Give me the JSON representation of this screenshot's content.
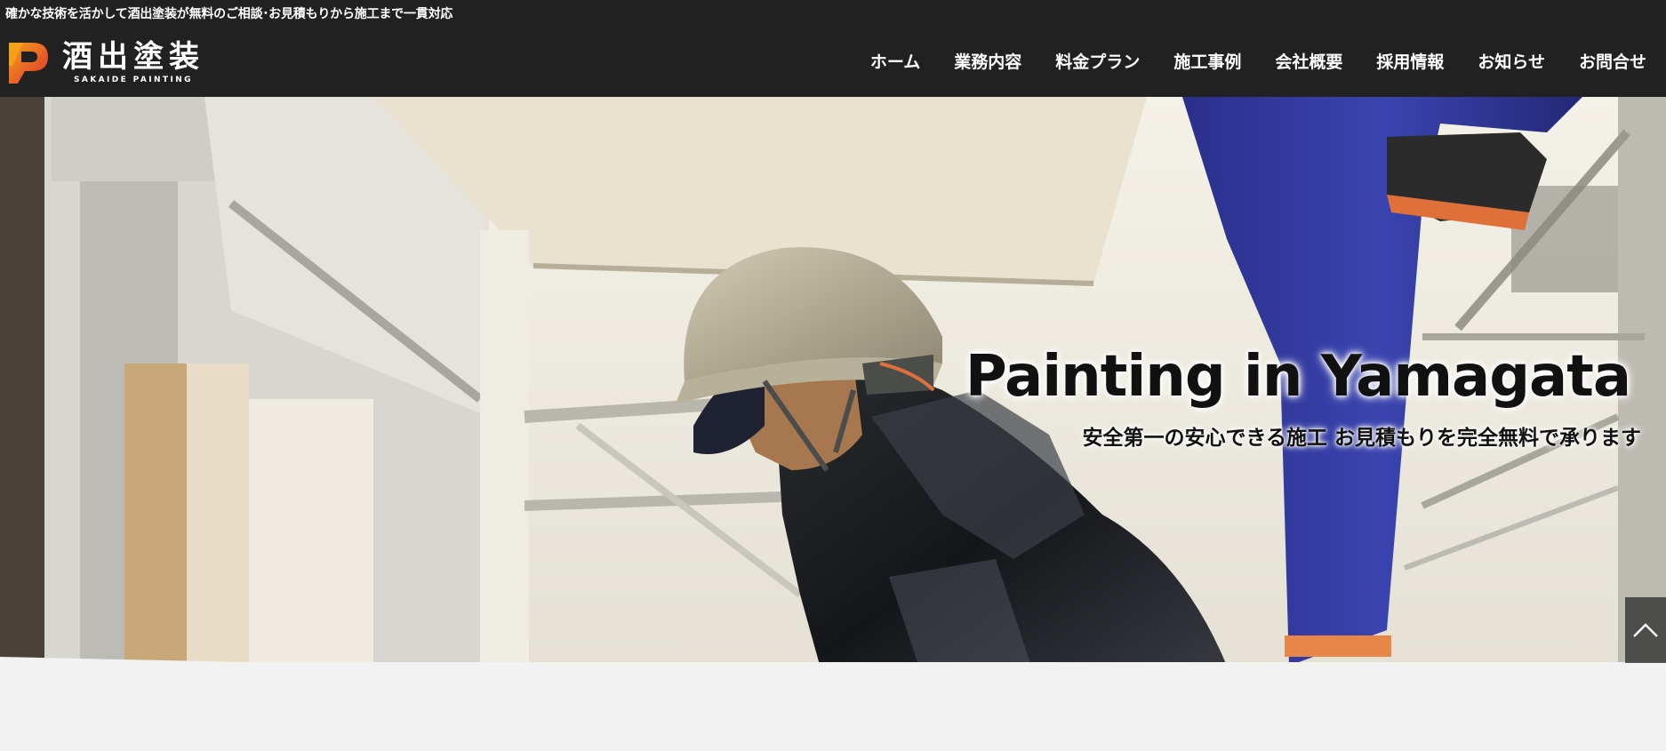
{
  "header": {
    "tagline": "確かな技術を活かして酒出塗装が無料のご相談･お見積もりから施工まで一貫対応",
    "logo": {
      "title": "酒出塗装",
      "subtitle": "SAKAIDE PAINTING",
      "mark_icon": "p-letter-logo-icon",
      "colors": {
        "orange": "#f5a21a",
        "red": "#e0302c"
      }
    },
    "nav": [
      {
        "label": "ホーム"
      },
      {
        "label": "業務内容"
      },
      {
        "label": "料金プラン"
      },
      {
        "label": "施工事例"
      },
      {
        "label": "会社概要"
      },
      {
        "label": "採用情報"
      },
      {
        "label": "お知らせ"
      },
      {
        "label": "お問合せ"
      }
    ],
    "background": "#212121"
  },
  "hero": {
    "title": "Painting in Yamagata",
    "subtitle": "安全第一の安心できる施工 お見積もりを完全無料で承ります",
    "image": "worker-in-helmet-on-scaffolding-photo"
  },
  "back_to_top": {
    "icon": "chevron-up-icon"
  }
}
